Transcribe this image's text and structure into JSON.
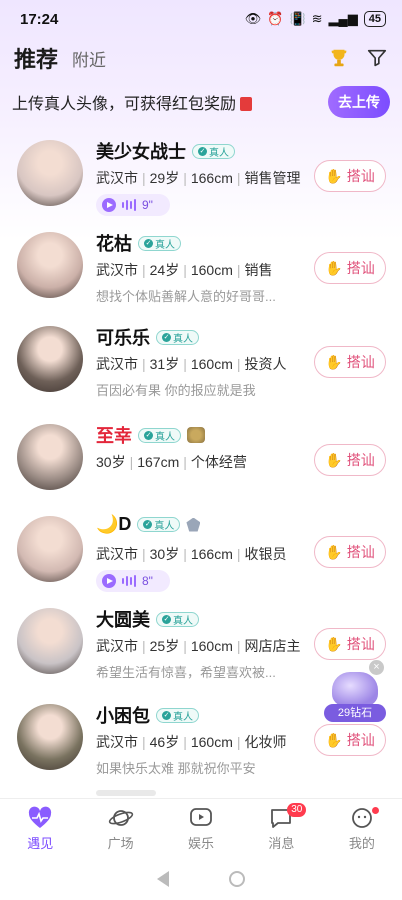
{
  "status": {
    "time": "17:24",
    "battery": "45"
  },
  "header": {
    "tab_active": "推荐",
    "tab_inactive": "附近"
  },
  "banner": {
    "text": "上传真人头像，可获得红包奖励",
    "button": "去上传"
  },
  "verified_label": "真人",
  "greet_label": "搭讪",
  "users": [
    {
      "name": "美少女战士",
      "city": "武汉市",
      "age": "29岁",
      "height": "166cm",
      "job": "销售管理",
      "bio": "",
      "voice": "9\"",
      "verified": true,
      "avatar_color": "#d8c6c2"
    },
    {
      "name": "花枯",
      "city": "武汉市",
      "age": "24岁",
      "height": "160cm",
      "job": "销售",
      "bio": "想找个体贴善解人意的好哥哥...",
      "voice": "",
      "verified": true,
      "avatar_color": "#cbb0a8"
    },
    {
      "name": "可乐乐",
      "city": "武汉市",
      "age": "31岁",
      "height": "160cm",
      "job": "投资人",
      "bio": "百因必有果 你的报应就是我",
      "voice": "",
      "verified": true,
      "avatar_color": "#6e6058"
    },
    {
      "name": "至幸",
      "city": "",
      "age": "30岁",
      "height": "167cm",
      "job": "个体经营",
      "bio": "",
      "voice": "",
      "verified": true,
      "avatar_color": "#9c8d86"
    },
    {
      "name": "🌙D",
      "city": "武汉市",
      "age": "30岁",
      "height": "166cm",
      "job": "收银员",
      "bio": "",
      "voice": "8\"",
      "verified": true,
      "avatar_color": "#d2b9b2"
    },
    {
      "name": "大圆美",
      "city": "武汉市",
      "age": "25岁",
      "height": "160cm",
      "job": "网店店主",
      "bio": "希望生活有惊喜，希望喜欢被...",
      "voice": "",
      "verified": true,
      "avatar_color": "#c9c3c6"
    },
    {
      "name": "小困包",
      "city": "武汉市",
      "age": "46岁",
      "height": "160cm",
      "job": "化妆师",
      "bio": "如果快乐太难 那就祝你平安",
      "voice": "",
      "verified": true,
      "avatar_color": "#7a7360"
    }
  ],
  "float_reward": {
    "label": "29钻石"
  },
  "tabbar": [
    {
      "label": "遇见",
      "icon": "heartbeat-icon",
      "active": true,
      "badge": ""
    },
    {
      "label": "广场",
      "icon": "planet-icon",
      "active": false,
      "badge": ""
    },
    {
      "label": "娱乐",
      "icon": "play-box-icon",
      "active": false,
      "badge": ""
    },
    {
      "label": "消息",
      "icon": "chat-icon",
      "active": false,
      "badge": "30"
    },
    {
      "label": "我的",
      "icon": "profile-icon",
      "active": false,
      "badge": "dot"
    }
  ],
  "colors": {
    "accent": "#7c4dff",
    "greet": "#e0507a",
    "red_name": "#e3263a"
  }
}
